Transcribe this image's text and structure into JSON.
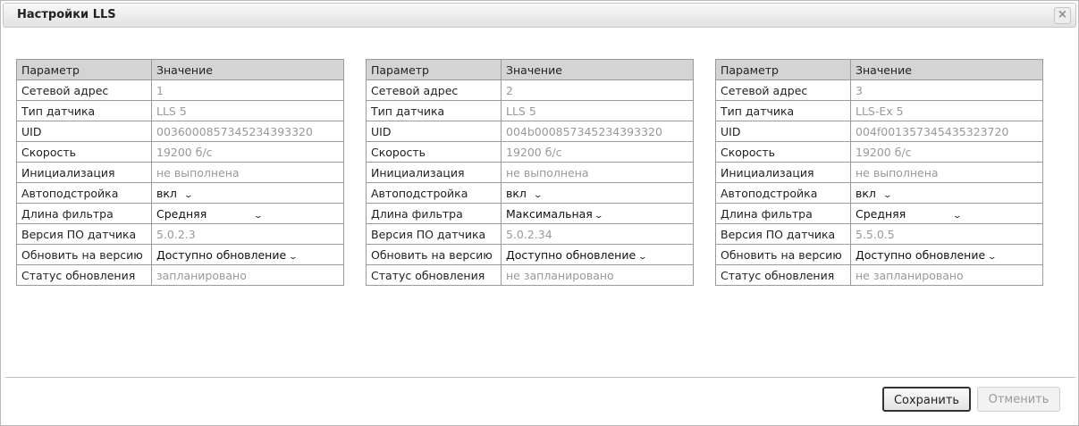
{
  "dialog": {
    "title": "Настройки LLS",
    "close_symbol": "×"
  },
  "headers": {
    "param": "Параметр",
    "value": "Значение"
  },
  "row_labels": [
    "Сетевой адрес",
    "Тип датчика",
    "UID",
    "Скорость",
    "Инициализация",
    "Автоподстройка",
    "Длина фильтра",
    "Версия ПО датчика",
    "Обновить на версию",
    "Статус обновления"
  ],
  "sensors": [
    {
      "address": "1",
      "type": "LLS 5",
      "uid": "0036000857345234393320",
      "speed": "19200 б/с",
      "init": "не выполнена",
      "autotune": "вкл",
      "filter": "Средняя",
      "fw": "5.0.2.3",
      "update_to": "Доступно обновление",
      "update_status": "запланировано"
    },
    {
      "address": "2",
      "type": "LLS 5",
      "uid": "004b000857345234393320",
      "speed": "19200 б/с",
      "init": "не выполнена",
      "autotune": "вкл",
      "filter": "Максимальная",
      "fw": "5.0.2.34",
      "update_to": "Доступно обновление",
      "update_status": "не запланировано"
    },
    {
      "address": "3",
      "type": "LLS-Ex 5",
      "uid": "004f001357345435323720",
      "speed": "19200 б/с",
      "init": "не выполнена",
      "autotune": "вкл",
      "filter": "Средняя",
      "fw": "5.5.0.5",
      "update_to": "Доступно обновление",
      "update_status": "не запланировано"
    }
  ],
  "buttons": {
    "save": "Сохранить",
    "cancel": "Отменить"
  }
}
